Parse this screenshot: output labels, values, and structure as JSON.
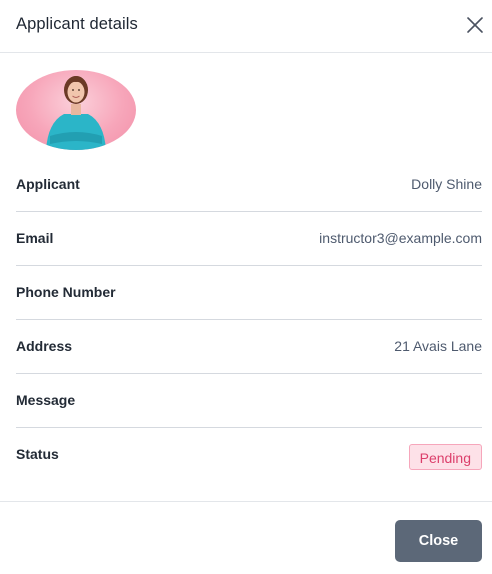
{
  "modal": {
    "title": "Applicant details",
    "close_icon": "close-icon"
  },
  "avatar": {
    "icon": "applicant-photo"
  },
  "details": [
    {
      "label": "Applicant",
      "value": "Dolly Shine"
    },
    {
      "label": "Email",
      "value": "instructor3@example.com"
    },
    {
      "label": "Phone Number",
      "value": ""
    },
    {
      "label": "Address",
      "value": "21 Avais Lane"
    },
    {
      "label": "Message",
      "value": ""
    },
    {
      "label": "Status",
      "value": "Pending"
    }
  ],
  "footer": {
    "close_label": "Close"
  },
  "colors": {
    "badge_text": "#dc3f6b",
    "badge_bg": "#fde1e8",
    "close_button_bg": "#5c6878"
  }
}
